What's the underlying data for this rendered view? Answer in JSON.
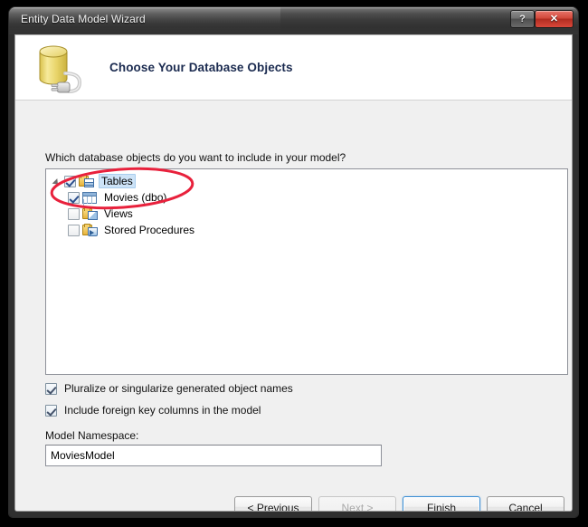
{
  "window": {
    "title": "Entity Data Model Wizard",
    "help_button": "?",
    "close_button": "✕"
  },
  "banner": {
    "title": "Choose Your Database Objects",
    "icon": "database-plug-icon"
  },
  "main": {
    "question": "Which database objects do you want to include in your model?"
  },
  "tree": {
    "nodes": [
      {
        "label": "Tables",
        "checked": true,
        "expanded": true,
        "selected": true,
        "icon": "tables-folder-icon"
      },
      {
        "label": "Movies (dbo)",
        "checked": true,
        "icon": "table-icon"
      },
      {
        "label": "Views",
        "checked": false,
        "icon": "views-folder-icon"
      },
      {
        "label": "Stored Procedures",
        "checked": false,
        "icon": "stored-procedures-folder-icon"
      }
    ]
  },
  "options": [
    {
      "label": "Pluralize or singularize generated object names",
      "checked": true
    },
    {
      "label": "Include foreign key columns in the model",
      "checked": true
    }
  ],
  "namespace": {
    "label": "Model Namespace:",
    "value": "MoviesModel",
    "placeholder": ""
  },
  "footer": {
    "previous": "< Previous",
    "next": "Next >",
    "finish": "Finish",
    "cancel": "Cancel"
  },
  "annotation": {
    "shape": "red-ellipse",
    "color": "#e8213c"
  },
  "colors": {
    "accent": "#3c8fd4",
    "annotation": "#e8213c",
    "dialog_bg": "#f0f0f0",
    "banner_bg": "#ffffff",
    "titlebar": "#343434",
    "close_button": "#c2392b",
    "selection": "#cde3f7"
  }
}
